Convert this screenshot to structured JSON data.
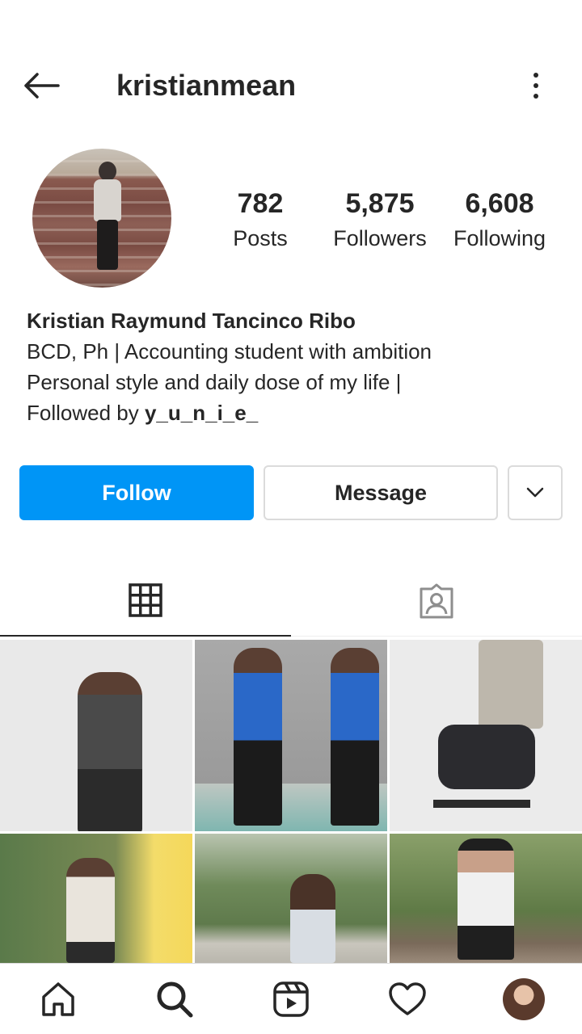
{
  "header": {
    "username": "kristianmean"
  },
  "stats": [
    {
      "value": "782",
      "label": "Posts"
    },
    {
      "value": "5,875",
      "label": "Followers"
    },
    {
      "value": "6,608",
      "label": "Following"
    }
  ],
  "bio": {
    "name": "Kristian Raymund Tancinco Ribo",
    "line1": "BCD, Ph | Accounting student with ambition",
    "line2": "Personal style and daily dose of my life |",
    "followed_by_prefix": "Followed by ",
    "followed_by_user": "y_u_n_i_e_"
  },
  "actions": {
    "follow_label": "Follow",
    "message_label": "Message"
  },
  "tabs": [
    {
      "icon": "grid-icon",
      "active": true
    },
    {
      "icon": "tagged-icon",
      "active": false
    }
  ],
  "bottom_nav": [
    "home-icon",
    "search-icon",
    "reels-icon",
    "heart-icon",
    "profile-avatar"
  ],
  "colors": {
    "primary": "#0095f6",
    "text": "#262626",
    "border": "#dbdbdb"
  }
}
